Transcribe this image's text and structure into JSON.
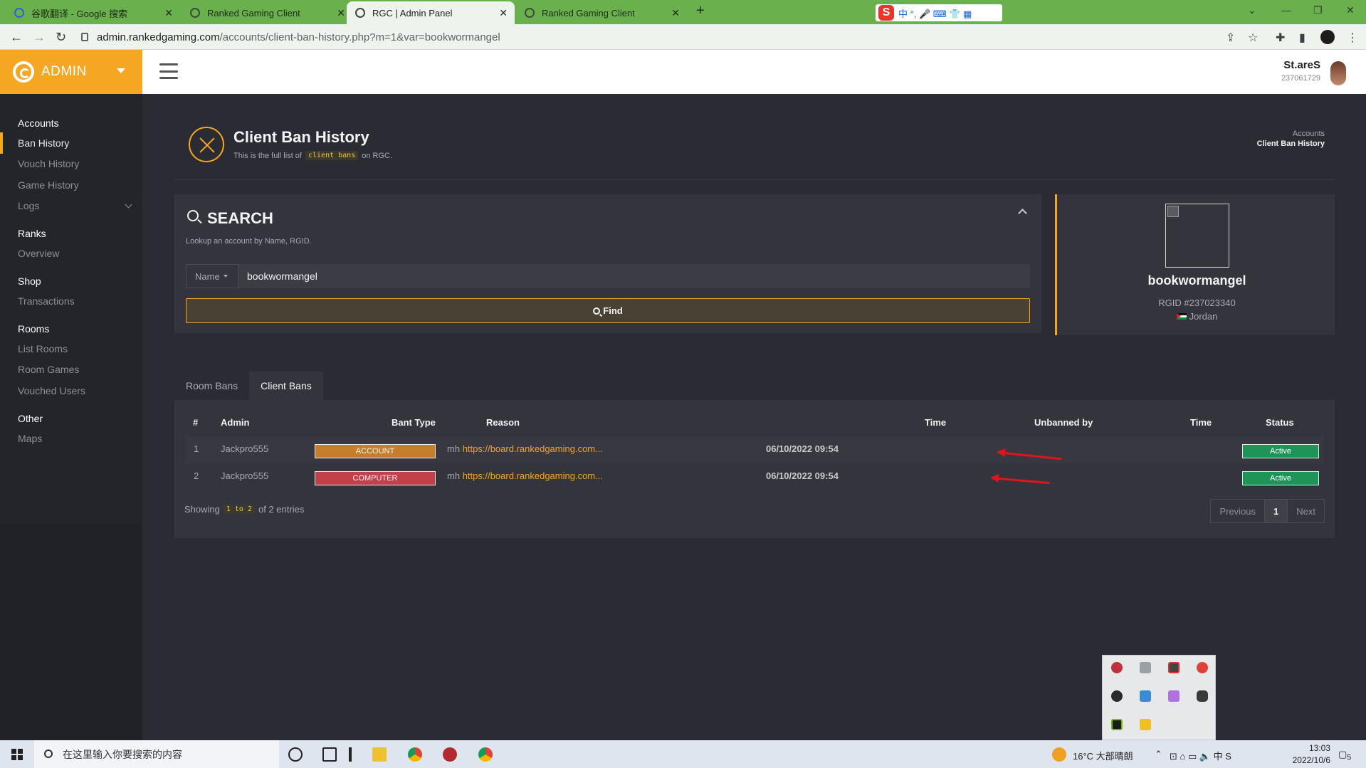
{
  "browser": {
    "tabs": [
      {
        "title": "谷歌翻译 - Google 搜索",
        "active": false
      },
      {
        "title": "Ranked Gaming Client",
        "active": false
      },
      {
        "title": "RGC | Admin Panel",
        "active": true
      },
      {
        "title": "Ranked Gaming Client",
        "active": false
      }
    ],
    "ime": {
      "logo": "S",
      "items": "中 °, 🎤 ⌨ 👕 ▦"
    },
    "url_host": "admin.rankedgaming.com",
    "url_path": "/accounts/client-ban-history.php?m=1&var=bookwormangel"
  },
  "brand": {
    "title": "ADMIN"
  },
  "user": {
    "name": "St.areS",
    "id": "237061729"
  },
  "sidebar": {
    "sections": [
      {
        "heading": "Accounts",
        "items": [
          "Ban History",
          "Vouch History",
          "Game History",
          "Logs"
        ]
      },
      {
        "heading": "Ranks",
        "items": [
          "Overview"
        ]
      },
      {
        "heading": "Shop",
        "items": [
          "Transactions"
        ]
      },
      {
        "heading": "Rooms",
        "items": [
          "List Rooms",
          "Room Games",
          "Vouched Users"
        ]
      },
      {
        "heading": "Other",
        "items": [
          "Maps"
        ]
      }
    ],
    "active_item": "Ban History"
  },
  "page": {
    "title": "Client Ban History",
    "subtitle_pre": "This is the full list of",
    "subtitle_code": "client bans",
    "subtitle_post": "on RGC.",
    "breadcrumb": [
      "Accounts",
      "Client Ban History"
    ]
  },
  "search": {
    "title": "SEARCH",
    "hint": "Lookup an account by Name, RGID.",
    "type_label": "Name",
    "value": "bookwormangel",
    "button": "Find"
  },
  "profile": {
    "name": "bookwormangel",
    "rgid": "RGID #237023340",
    "country": "Jordan"
  },
  "tabs": [
    "Room Bans",
    "Client Bans"
  ],
  "active_tab": "Client Bans",
  "table": {
    "columns": [
      "#",
      "Admin",
      "Bant Type",
      "Reason",
      "Time",
      "Unbanned by",
      "Time",
      "Status"
    ],
    "rows": [
      {
        "num": "1",
        "admin": "Jackpro555",
        "type": "ACCOUNT",
        "reason_prefix": "mh",
        "reason_link": "https://board.rankedgaming.com...",
        "time": "06/10/2022 09:54",
        "unbanned_by": "",
        "unban_time": "",
        "status": "Active"
      },
      {
        "num": "2",
        "admin": "Jackpro555",
        "type": "COMPUTER",
        "reason_prefix": "mh",
        "reason_link": "https://board.rankedgaming.com...",
        "time": "06/10/2022 09:54",
        "unbanned_by": "",
        "unban_time": "",
        "status": "Active"
      }
    ],
    "showing_pre": "Showing",
    "showing_code": "1 to 2",
    "showing_post": "of 2 entries",
    "pager": [
      "Previous",
      "1",
      "Next"
    ]
  },
  "taskbar": {
    "search_placeholder": "在这里输入你要搜索的内容",
    "weather": "16°C 大部晴朗",
    "time": "13:03",
    "date": "2022/10/6",
    "notif_count": "5"
  },
  "colors": {
    "accent": "#f5a623",
    "active_status": "#1f9459",
    "account_badge": "#c77e2a",
    "computer_badge": "#c2404a",
    "browser_frame": "#6ab04c"
  }
}
